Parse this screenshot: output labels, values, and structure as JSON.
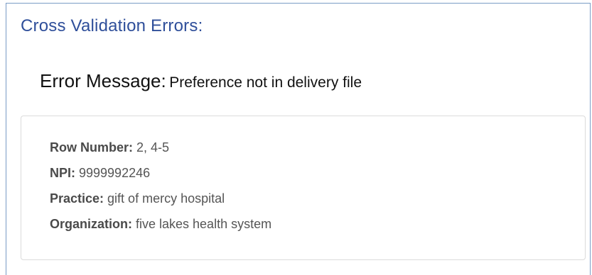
{
  "section_title": "Cross Validation Errors:",
  "error": {
    "label": "Error Message:",
    "message": "Preference not in delivery file"
  },
  "details": {
    "row_number": {
      "label": "Row Number:",
      "value": " 2, 4-5"
    },
    "npi": {
      "label": "NPI:",
      "value": " 9999992246"
    },
    "practice": {
      "label": "Practice:",
      "value": " gift of mercy hospital"
    },
    "organization": {
      "label": "Organization:",
      "value": " five lakes health system"
    }
  },
  "colors": {
    "title": "#2f4f9a",
    "panel_border": "#7a9cc6",
    "box_border": "#dcdcdc"
  }
}
